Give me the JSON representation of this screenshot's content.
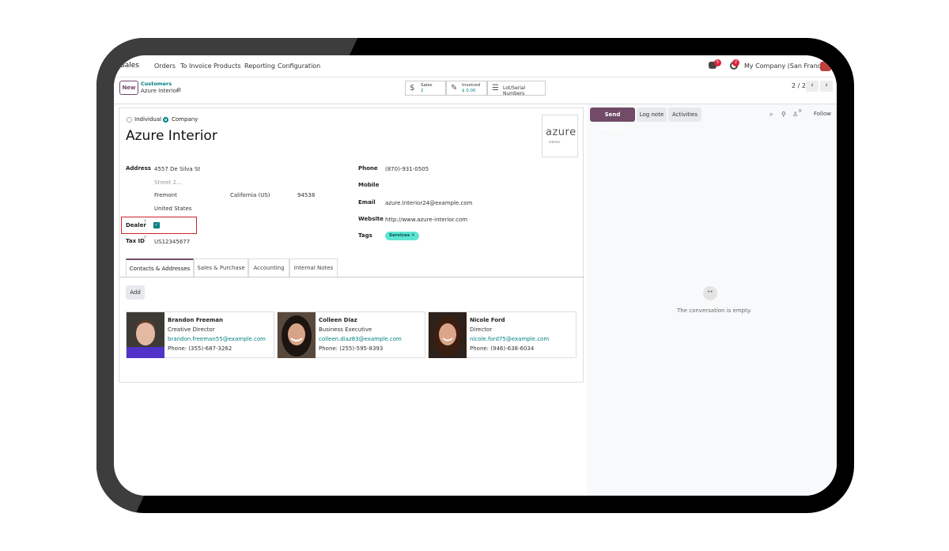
{
  "topbar": {
    "app_name": "Sales",
    "menu": [
      "Orders",
      "To Invoice",
      "Products",
      "Reporting",
      "Configuration"
    ],
    "chat_badge": "5",
    "activity_badge": "2",
    "company": "My Company (San Francisco)"
  },
  "control": {
    "new_label": "New",
    "breadcrumb_parent": "Customers",
    "breadcrumb_current": "Azure Interior",
    "smart_buttons": {
      "sales_label": "Sales",
      "sales_value": "2",
      "invoiced_label": "Invoiced",
      "invoiced_value": "$ 0.00",
      "lots_label": "Lot/Serial Numbers"
    },
    "pager": "2 / 2"
  },
  "form": {
    "type_individual": "Individual",
    "type_company": "Company",
    "name": "Azure Interior",
    "logo_text": "azure",
    "logo_sub": "interior",
    "address_label": "Address",
    "street": "4557 De Silva St",
    "street2_placeholder": "Street 2...",
    "city": "Fremont",
    "state": "California (US)",
    "zip": "94538",
    "country": "United States",
    "dealer_label": "Dealer",
    "tax_label": "Tax ID",
    "tax_value": "US12345677",
    "phone_label": "Phone",
    "phone_value": "(870)-931-0505",
    "mobile_label": "Mobile",
    "email_label": "Email",
    "email_value": "azure.Interior24@example.com",
    "website_label": "Website",
    "website_value": "http://www.azure-interior.com",
    "tags_label": "Tags",
    "tag_value": "Services"
  },
  "tabs": [
    "Contacts & Addresses",
    "Sales & Purchase",
    "Accounting",
    "Internal Notes"
  ],
  "contacts": {
    "add_label": "Add",
    "cards": [
      {
        "name": "Brandon Freeman",
        "role": "Creative Director",
        "email": "brandon.freeman55@example.com",
        "phone": "Phone: (355)-687-3262"
      },
      {
        "name": "Colleen Diaz",
        "role": "Business Executive",
        "email": "colleen.diaz83@example.com",
        "phone": "Phone: (255)-595-8393"
      },
      {
        "name": "Nicole Ford",
        "role": "Director",
        "email": "nicole.ford75@example.com",
        "phone": "Phone: (946)-638-6034"
      }
    ]
  },
  "chatter": {
    "send_message": "Send message",
    "log_note": "Log note",
    "activities": "Activities",
    "followers_count": "0",
    "follow": "Follow",
    "empty_text": "The conversation is empty."
  }
}
